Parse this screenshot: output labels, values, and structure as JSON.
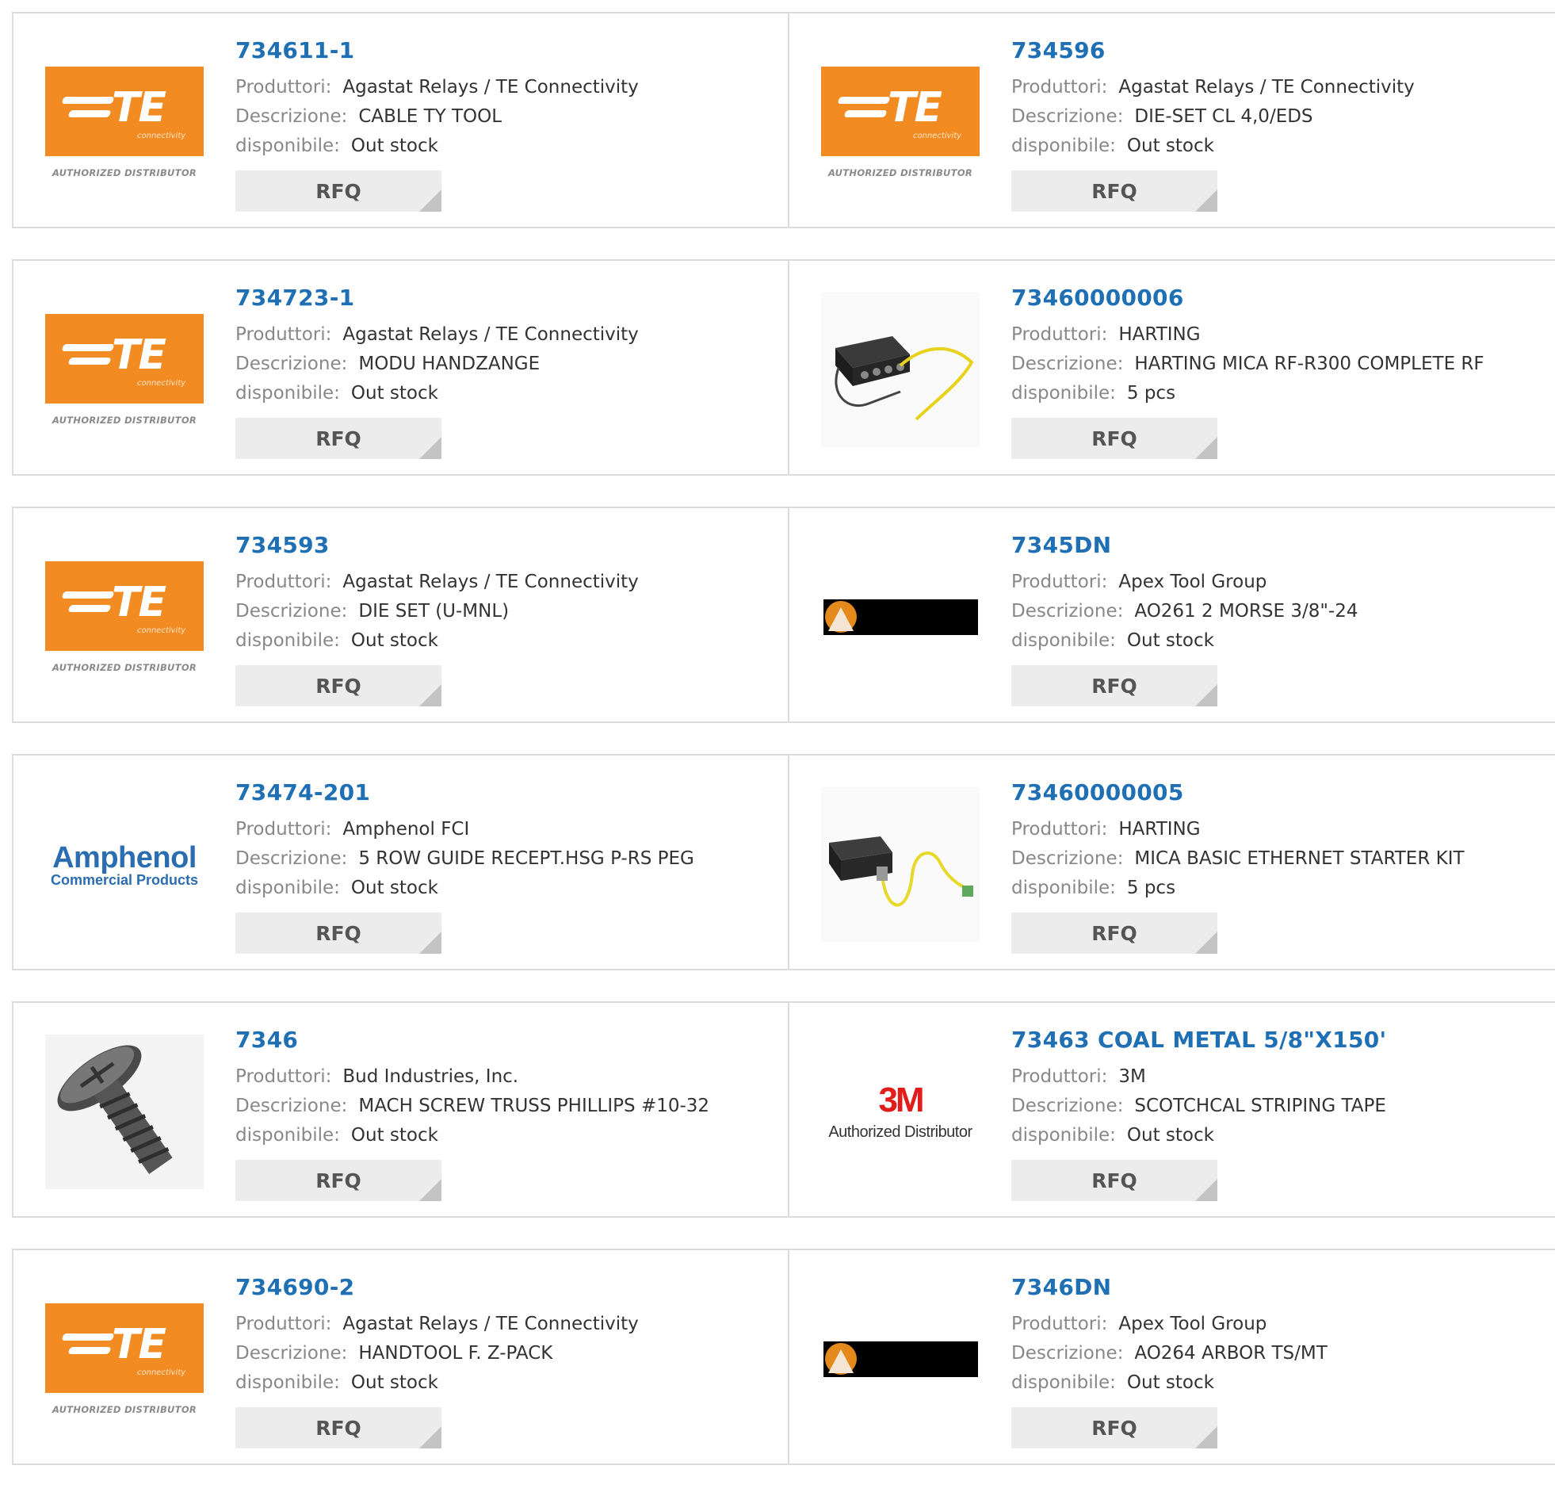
{
  "labels": {
    "producer": "Produttori:",
    "description": "Descrizione:",
    "availability": "disponibile:",
    "rfq": "RFQ"
  },
  "logos": {
    "te": {
      "letters": "TE",
      "sub": "connectivity",
      "auth": "AUTHORIZED DISTRIBUTOR"
    },
    "amphenol": {
      "name": "Amphenol",
      "sub": "Commercial Products"
    },
    "mmm": {
      "name": "3M",
      "sub": "Authorized Distributor"
    }
  },
  "products": [
    {
      "pn": "734611-1",
      "producer": "Agastat Relays / TE Connectivity",
      "description": "CABLE TY TOOL",
      "availability": "Out stock",
      "image": "te-logo"
    },
    {
      "pn": "734596",
      "producer": "Agastat Relays / TE Connectivity",
      "description": "DIE-SET CL 4,0/EDS",
      "availability": "Out stock",
      "image": "te-logo"
    },
    {
      "pn": "734723-1",
      "producer": "Agastat Relays / TE Connectivity",
      "description": "MODU HANDZANGE",
      "availability": "Out stock",
      "image": "te-logo"
    },
    {
      "pn": "73460000006",
      "producer": "HARTING",
      "description": "HARTING MICA RF-R300 COMPLETE RF",
      "availability": "5 pcs",
      "image": "harting-rf-device"
    },
    {
      "pn": "734593",
      "producer": "Agastat Relays / TE Connectivity",
      "description": "DIE SET (U-MNL)",
      "availability": "Out stock",
      "image": "te-logo"
    },
    {
      "pn": "7345DN",
      "producer": "Apex Tool Group",
      "description": "AO261 2 MORSE 3/8\"-24",
      "availability": "Out stock",
      "image": "apex-logo"
    },
    {
      "pn": "73474-201",
      "producer": "Amphenol FCI",
      "description": "5 ROW GUIDE RECEPT.HSG P-RS PEG",
      "availability": "Out stock",
      "image": "amphenol-logo"
    },
    {
      "pn": "73460000005",
      "producer": "HARTING",
      "description": "MICA BASIC ETHERNET STARTER KIT",
      "availability": "5 pcs",
      "image": "harting-ethernet-kit"
    },
    {
      "pn": "7346",
      "producer": "Bud Industries, Inc.",
      "description": "MACH SCREW TRUSS PHILLIPS #10-32",
      "availability": "Out stock",
      "image": "screw-photo"
    },
    {
      "pn": "73463 COAL METAL 5/8\"X150'",
      "producer": "3M",
      "description": "SCOTCHCAL STRIPING TAPE",
      "availability": "Out stock",
      "image": "3m-logo"
    },
    {
      "pn": "734690-2",
      "producer": "Agastat Relays / TE Connectivity",
      "description": "HANDTOOL F. Z-PACK",
      "availability": "Out stock",
      "image": "te-logo"
    },
    {
      "pn": "7346DN",
      "producer": "Apex Tool Group",
      "description": "AO264 ARBOR TS/MT",
      "availability": "Out stock",
      "image": "apex-logo"
    }
  ]
}
